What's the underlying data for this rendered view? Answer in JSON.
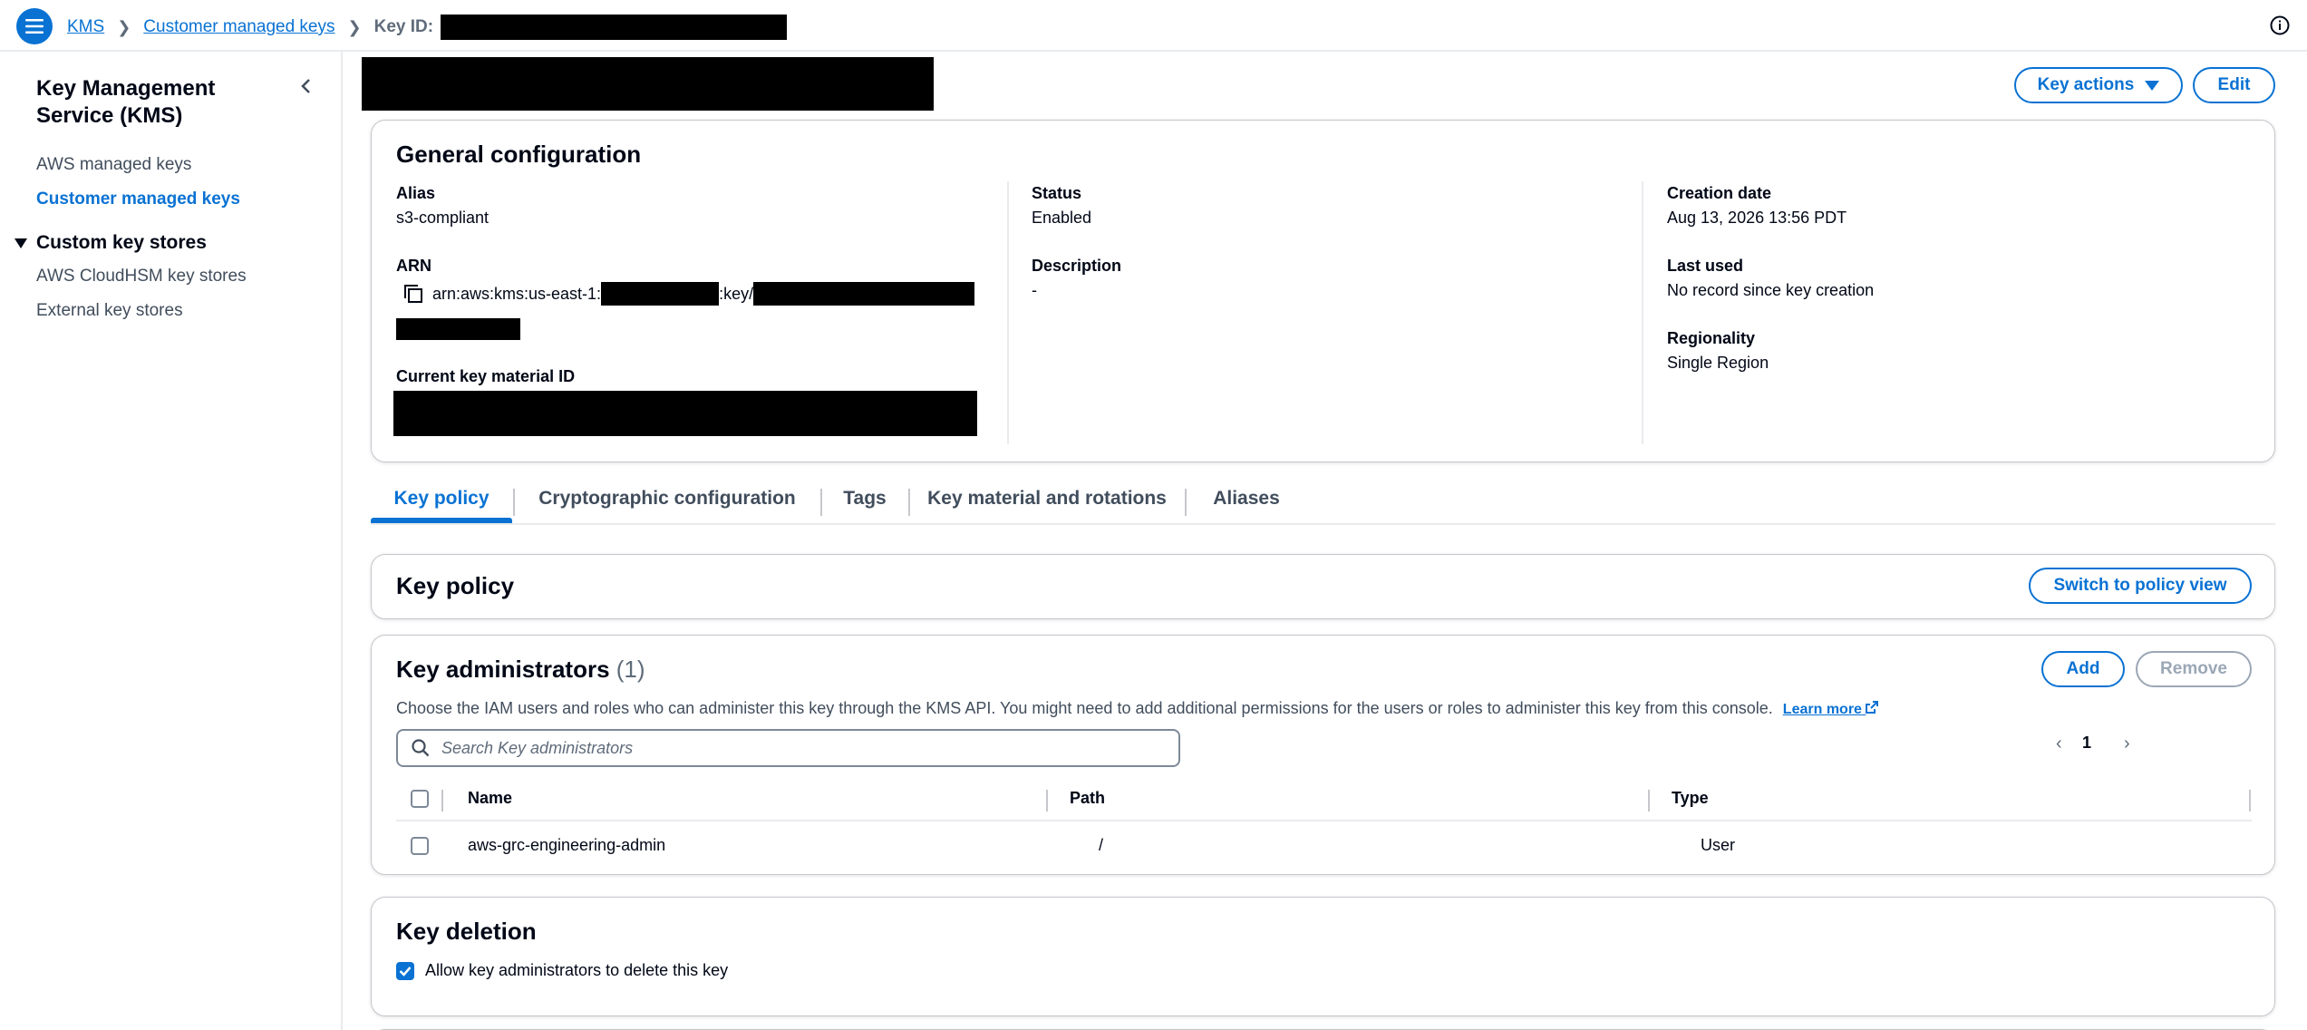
{
  "topbar": {
    "breadcrumb_service": "KMS",
    "breadcrumb_section": "Customer managed keys",
    "breadcrumb_current_label": "Key ID:"
  },
  "sidebar": {
    "title": "Key Management Service (KMS)",
    "items": [
      {
        "label": "AWS managed keys",
        "active": false
      },
      {
        "label": "Customer managed keys",
        "active": true
      }
    ],
    "section": "Custom key stores",
    "section_items": [
      {
        "label": "AWS CloudHSM key stores"
      },
      {
        "label": "External key stores"
      }
    ]
  },
  "header": {
    "key_actions_label": "Key actions",
    "edit_label": "Edit"
  },
  "general": {
    "title": "General configuration",
    "alias_label": "Alias",
    "alias_value": "s3-compliant",
    "arn_label": "ARN",
    "arn_prefix": "arn:aws:kms:us-east-1:",
    "arn_key": ":key/",
    "key_material_label": "Current key material ID",
    "status_label": "Status",
    "status_value": "Enabled",
    "description_label": "Description",
    "description_value": "-",
    "creation_label": "Creation date",
    "creation_value": "Aug 13, 2026 13:56 PDT",
    "last_used_label": "Last used",
    "last_used_value": "No record since key creation",
    "regionality_label": "Regionality",
    "regionality_value": "Single Region"
  },
  "tabs": [
    {
      "label": "Key policy",
      "active": true
    },
    {
      "label": "Cryptographic configuration",
      "active": false
    },
    {
      "label": "Tags",
      "active": false
    },
    {
      "label": "Key material and rotations",
      "active": false
    },
    {
      "label": "Aliases",
      "active": false
    }
  ],
  "key_policy": {
    "title": "Key policy",
    "switch_label": "Switch to policy view"
  },
  "admins": {
    "title": "Key administrators",
    "count": "(1)",
    "description": "Choose the IAM users and roles who can administer this key through the KMS API. You might need to add additional permissions for the users or roles to administer this key from this console.",
    "learn_more": "Learn more",
    "add_label": "Add",
    "remove_label": "Remove",
    "search_placeholder": "Search Key administrators",
    "page": "1",
    "columns": [
      "Name",
      "Path",
      "Type"
    ],
    "rows": [
      {
        "name": "aws-grc-engineering-admin",
        "path": "/",
        "type": "User"
      }
    ]
  },
  "deletion": {
    "title": "Key deletion",
    "checkbox_label": "Allow key administrators to delete this key",
    "checked": true
  },
  "colors": {
    "accent": "#0972d3",
    "text": "#000716",
    "muted": "#5f6b7a",
    "border": "#c6c6cd"
  }
}
